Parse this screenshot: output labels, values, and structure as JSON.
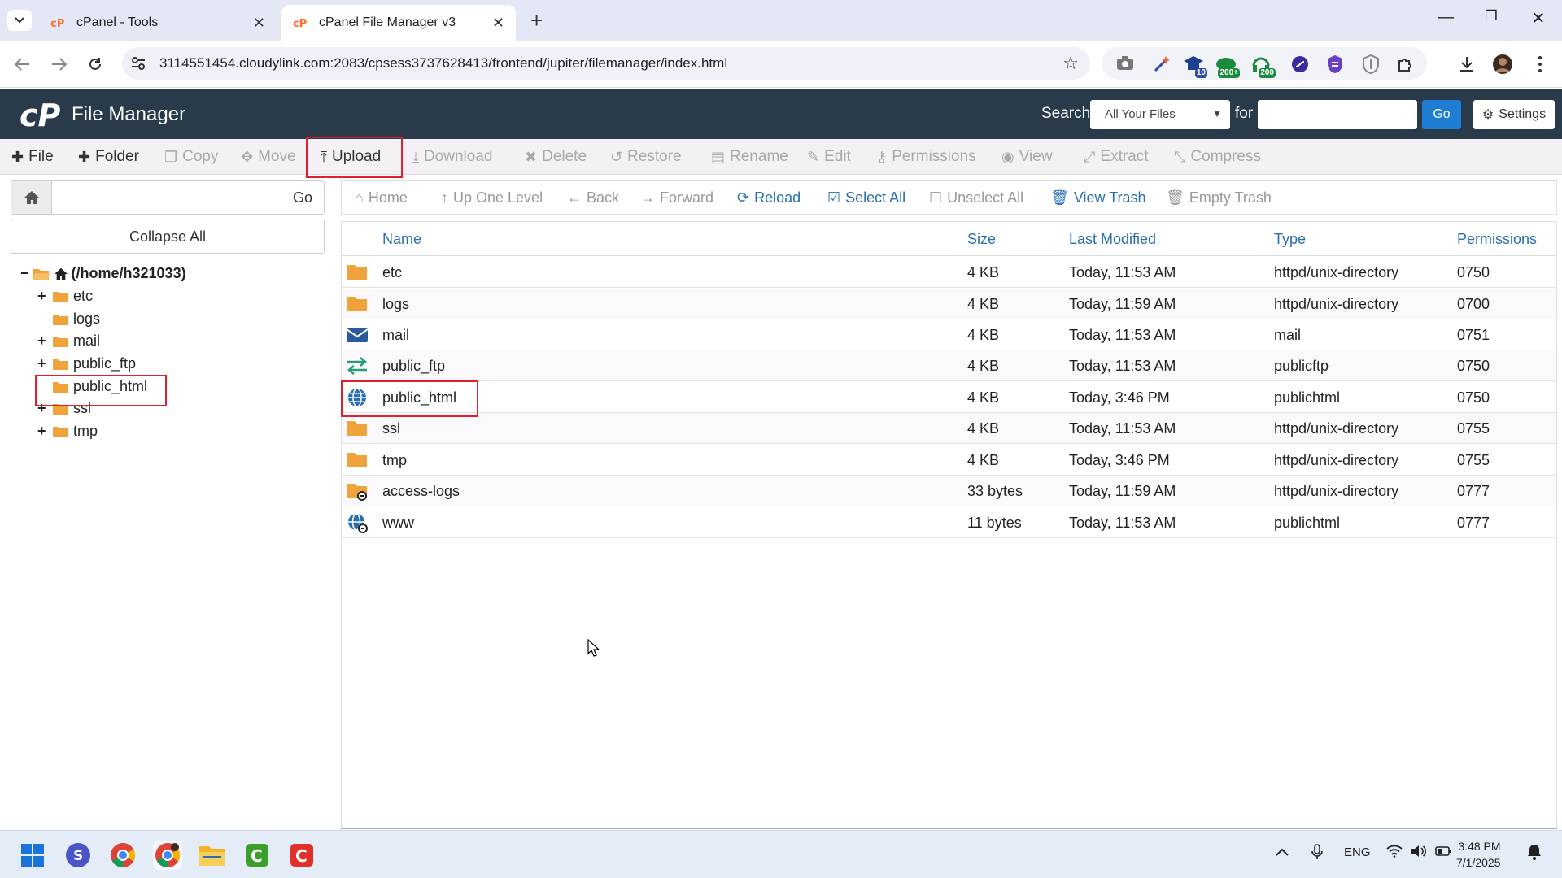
{
  "browser": {
    "tabs": [
      {
        "title": "cPanel - Tools",
        "active": false
      },
      {
        "title": "cPanel File Manager v3",
        "active": true
      }
    ],
    "url": "3114551454.cloudylink.com:2083/cpsess3737628413/frontend/jupiter/filemanager/index.html",
    "extension_badges": [
      "10",
      "200+",
      "200"
    ]
  },
  "header": {
    "app_title": "File Manager",
    "search_label": "Search",
    "search_scope": "All Your Files",
    "for_label": "for",
    "search_value": "",
    "go_label": "Go",
    "settings_label": "Settings"
  },
  "toolbar": {
    "items": [
      {
        "label": "File",
        "icon": "plus-icon",
        "enabled": true
      },
      {
        "label": "Folder",
        "icon": "plus-icon",
        "enabled": true
      },
      {
        "label": "Copy",
        "icon": "copy-icon",
        "enabled": false
      },
      {
        "label": "Move",
        "icon": "move-icon",
        "enabled": false
      },
      {
        "label": "Upload",
        "icon": "upload-icon",
        "enabled": true
      },
      {
        "label": "Download",
        "icon": "download-icon",
        "enabled": false
      },
      {
        "label": "Delete",
        "icon": "delete-icon",
        "enabled": false
      },
      {
        "label": "Restore",
        "icon": "restore-icon",
        "enabled": false
      },
      {
        "label": "Rename",
        "icon": "rename-icon",
        "enabled": false
      },
      {
        "label": "Edit",
        "icon": "edit-icon",
        "enabled": false
      },
      {
        "label": "Permissions",
        "icon": "key-icon",
        "enabled": false
      },
      {
        "label": "View",
        "icon": "eye-icon",
        "enabled": false
      },
      {
        "label": "Extract",
        "icon": "extract-icon",
        "enabled": false
      },
      {
        "label": "Compress",
        "icon": "compress-icon",
        "enabled": false
      }
    ]
  },
  "sidebar": {
    "path_value": "",
    "go_label": "Go",
    "collapse_label": "Collapse All",
    "root_label": "(/home/h321033)",
    "tree": [
      {
        "label": "etc",
        "expandable": true
      },
      {
        "label": "logs",
        "expandable": false
      },
      {
        "label": "mail",
        "expandable": true
      },
      {
        "label": "public_ftp",
        "expandable": true
      },
      {
        "label": "public_html",
        "expandable": false
      },
      {
        "label": "ssl",
        "expandable": true
      },
      {
        "label": "tmp",
        "expandable": true
      }
    ]
  },
  "nav_toolbar": {
    "items": [
      {
        "label": "Home",
        "enabled": false
      },
      {
        "label": "Up One Level",
        "enabled": false
      },
      {
        "label": "Back",
        "enabled": false
      },
      {
        "label": "Forward",
        "enabled": false
      },
      {
        "label": "Reload",
        "enabled": true
      },
      {
        "label": "Select All",
        "enabled": true
      },
      {
        "label": "Unselect All",
        "enabled": false
      },
      {
        "label": "View Trash",
        "enabled": true
      },
      {
        "label": "Empty Trash",
        "enabled": false
      }
    ]
  },
  "file_table": {
    "columns": [
      "Name",
      "Size",
      "Last Modified",
      "Type",
      "Permissions"
    ],
    "rows": [
      {
        "icon": "folder-icon",
        "name": "etc",
        "size": "4 KB",
        "modified": "Today, 11:53 AM",
        "type": "httpd/unix-directory",
        "perms": "0750"
      },
      {
        "icon": "folder-icon",
        "name": "logs",
        "size": "4 KB",
        "modified": "Today, 11:59 AM",
        "type": "httpd/unix-directory",
        "perms": "0700"
      },
      {
        "icon": "mail-icon",
        "name": "mail",
        "size": "4 KB",
        "modified": "Today, 11:53 AM",
        "type": "mail",
        "perms": "0751"
      },
      {
        "icon": "ftp-arrows-icon",
        "name": "public_ftp",
        "size": "4 KB",
        "modified": "Today, 11:53 AM",
        "type": "publicftp",
        "perms": "0750"
      },
      {
        "icon": "globe-icon",
        "name": "public_html",
        "size": "4 KB",
        "modified": "Today, 3:46 PM",
        "type": "publichtml",
        "perms": "0750"
      },
      {
        "icon": "folder-icon",
        "name": "ssl",
        "size": "4 KB",
        "modified": "Today, 11:53 AM",
        "type": "httpd/unix-directory",
        "perms": "0755"
      },
      {
        "icon": "folder-icon",
        "name": "tmp",
        "size": "4 KB",
        "modified": "Today, 3:46 PM",
        "type": "httpd/unix-directory",
        "perms": "0755"
      },
      {
        "icon": "folder-link-icon",
        "name": "access-logs",
        "size": "33 bytes",
        "modified": "Today, 11:59 AM",
        "type": "httpd/unix-directory",
        "perms": "0777"
      },
      {
        "icon": "globe-link-icon",
        "name": "www",
        "size": "11 bytes",
        "modified": "Today, 11:53 AM",
        "type": "publichtml",
        "perms": "0777"
      }
    ]
  },
  "taskbar": {
    "language": "ENG",
    "time": "3:48 PM",
    "date": "7/1/2025"
  },
  "colors": {
    "header_bg": "#293a4a",
    "link_blue": "#2a6fb0",
    "folder_orange": "#f0a33a",
    "highlight_red": "#e0202a",
    "go_blue": "#1f7ed4"
  }
}
